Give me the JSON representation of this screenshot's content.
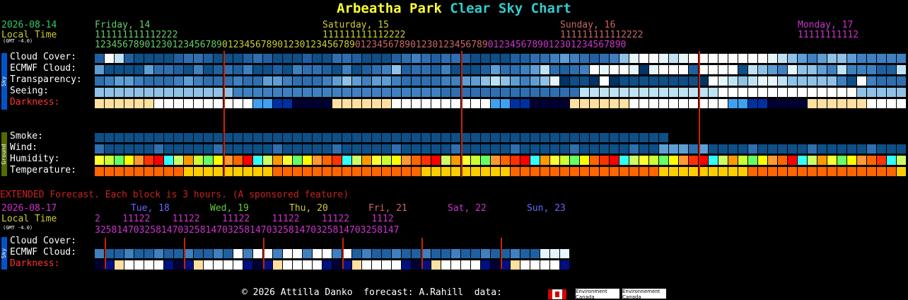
{
  "title": {
    "part1": "Arbeatha Park",
    "part2": "Clear Sky Chart"
  },
  "main": {
    "date": "2026-08-14",
    "local_time": "Local Time",
    "gmt": "(GMT -4.0)",
    "days": [
      {
        "label": "Friday, 14",
        "color": "#66cc66"
      },
      {
        "label": "Saturday, 15",
        "color": "#cccc33"
      },
      {
        "label": "Sunday, 16",
        "color": "#cc6666"
      },
      {
        "label": "Monday, 17",
        "color": "#cc33cc"
      }
    ],
    "hour_tens_rows": [
      "111111111112222",
      "111111111112222",
      "111111111112222",
      "11111111112"
    ],
    "hour_ones_rows": [
      "123456789012301234567890123456789012301234567890123456789012301234567890123456789012301234567890",
      ""
    ],
    "rows": {
      "cloud": "Cloud Cover:",
      "ecmwf": "ECMWF Cloud:",
      "transparency": "Transparency:",
      "seeing": "Seeing:",
      "darkness": "Darkness:",
      "smoke": "Smoke:",
      "wind": "Wind:",
      "humidity": "Humidity:",
      "temperature": "Temperature:"
    },
    "sky_tab": "Sky",
    "ground_tab": "Ground"
  },
  "extended": {
    "banner": "EXTENDED Forecast. Each block is 3 hours. (A sponsored feature)",
    "date": "2026-08-17",
    "local_time": "Local Time",
    "gmt": "(GMT -4.0)",
    "days": [
      {
        "label": "Tue, 18",
        "color": "#6666ff"
      },
      {
        "label": "Wed, 19",
        "color": "#66cc33"
      },
      {
        "label": "Thu, 20",
        "color": "#cccc33"
      },
      {
        "label": "Fri, 21",
        "color": "#cc6666"
      },
      {
        "label": "Sat, 22",
        "color": "#cc33cc"
      },
      {
        "label": "Sun, 23",
        "color": "#6666ff"
      }
    ],
    "tens": "2    11122    11122    11122    11122    11122    1112",
    "ones": "3258147032581470325814703258147032581470325814703258147",
    "rows": {
      "cloud": "Cloud Cover:",
      "ecmwf": "ECMWF Cloud:",
      "darkness": "Darkness:"
    },
    "sky_tab": "Sky"
  },
  "footer": {
    "text": "© 2026 Attilla Danko  forecast: A.Rahill  data:",
    "env1": "Environment\nCanada",
    "env2": "Environnement\nCanada"
  },
  "colors": {
    "cloud_levels": [
      "#003466",
      "#0d4f86",
      "#1f60a0",
      "#2f6fb0",
      "#3f80c0",
      "#5f9ed4",
      "#8fc2e6",
      "#bfe3f4",
      "#e6f6fa",
      "#ffffff"
    ],
    "darkness_levels": [
      "#000033",
      "#001080",
      "#0030a0",
      "#2060d0",
      "#40a0f0",
      "#ffe0a0",
      "#ffffff"
    ],
    "red_line": "#cc2200"
  }
}
